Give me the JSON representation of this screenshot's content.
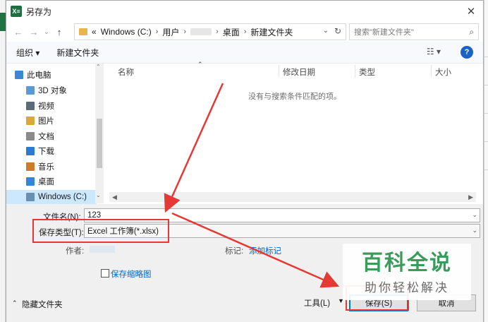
{
  "window": {
    "title": "另存为",
    "app_icon_text": "X≡",
    "close_glyph": "✕"
  },
  "navigation": {
    "back_glyph": "←",
    "forward_glyph": "→",
    "recent_glyph": "⌄",
    "up_glyph": "↑",
    "breadcrumb": {
      "overflow": "«",
      "drive": "Windows (C:)",
      "users": "用户",
      "desktop": "桌面",
      "folder": "新建文件夹"
    },
    "search_placeholder": "搜索\"新建文件夹\""
  },
  "toolbar": {
    "organize": "组织 ▾",
    "new_folder": "新建文件夹",
    "view_glyph": "☷ ▾",
    "help_glyph": "?"
  },
  "sidebar": {
    "items": [
      {
        "label": "此电脑",
        "icon": "computer-icon",
        "color": "#3b86d6"
      },
      {
        "label": "3D 对象",
        "icon": "folder-3d-icon",
        "color": "#5b9bd5"
      },
      {
        "label": "视频",
        "icon": "video-folder-icon",
        "color": "#5c6b7a"
      },
      {
        "label": "图片",
        "icon": "pictures-folder-icon",
        "color": "#d9a93a"
      },
      {
        "label": "文档",
        "icon": "documents-folder-icon",
        "color": "#8a8a8a"
      },
      {
        "label": "下载",
        "icon": "downloads-folder-icon",
        "color": "#2d7bd1"
      },
      {
        "label": "音乐",
        "icon": "music-folder-icon",
        "color": "#d07b2a"
      },
      {
        "label": "桌面",
        "icon": "desktop-folder-icon",
        "color": "#2e86de"
      },
      {
        "label": "Windows (C:)",
        "icon": "drive-icon",
        "color": "#6b8fb3"
      }
    ]
  },
  "file_list": {
    "columns": [
      "名称",
      "修改日期",
      "类型",
      "大小"
    ],
    "empty_message": "没有与搜索条件匹配的项。"
  },
  "form": {
    "filename_label": "文件名(N):",
    "filename_value": "123",
    "filetype_label": "保存类型(T):",
    "filetype_value": "Excel 工作簿(*.xlsx)",
    "author_label": "作者:",
    "tags_label": "标记:",
    "tags_link": "添加标记",
    "thumbnail_label": "保存缩略图",
    "hide_folders": "隐藏文件夹",
    "tools_label": "工具(L)",
    "save_button": "保存(S)",
    "cancel_button": "取消"
  },
  "watermark": {
    "title": "百科全说",
    "subtitle": "助你轻松解决"
  },
  "colors": {
    "annotation_red": "#e53935",
    "accent_blue": "#0078d7",
    "excel_green": "#217346"
  }
}
